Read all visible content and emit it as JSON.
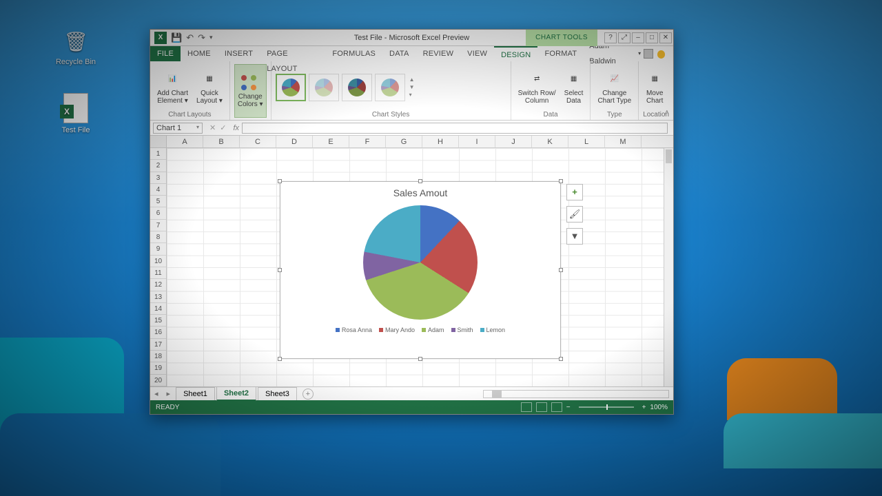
{
  "desktop": {
    "recycle": "Recycle Bin",
    "testfile": "Test File"
  },
  "window": {
    "title": "Test File - Microsoft Excel Preview",
    "contextual_tab": "CHART TOOLS",
    "user": "Adam Baldwin"
  },
  "tabs": {
    "file": "FILE",
    "home": "HOME",
    "insert": "INSERT",
    "pagelayout": "PAGE LAYOUT",
    "formulas": "FORMULAS",
    "data": "DATA",
    "review": "REVIEW",
    "view": "VIEW",
    "design": "DESIGN",
    "format": "FORMAT"
  },
  "ribbon": {
    "g1": {
      "btn1": "Add Chart\nElement ▾",
      "btn2": "Quick\nLayout ▾",
      "label": "Chart Layouts"
    },
    "g2": {
      "btn": "Change\nColors ▾",
      "label": ""
    },
    "g3": {
      "label": "Chart Styles"
    },
    "g4": {
      "btn1": "Switch Row/\nColumn",
      "btn2": "Select\nData",
      "label": "Data"
    },
    "g5": {
      "btn": "Change\nChart Type",
      "label": "Type"
    },
    "g6": {
      "btn": "Move\nChart",
      "label": "Location"
    }
  },
  "fx": {
    "namebox": "Chart 1"
  },
  "cols": [
    "A",
    "B",
    "C",
    "D",
    "E",
    "F",
    "G",
    "H",
    "I",
    "J",
    "K",
    "L",
    "M"
  ],
  "rows": [
    "1",
    "2",
    "3",
    "4",
    "5",
    "6",
    "7",
    "8",
    "9",
    "10",
    "11",
    "12",
    "13",
    "14",
    "15",
    "16",
    "17",
    "18",
    "19",
    "20"
  ],
  "chart_data": {
    "type": "pie",
    "title": "Sales Amout",
    "series": [
      {
        "name": "Rosa Anna",
        "value": 12,
        "color": "#4472c4"
      },
      {
        "name": "Mary Ando",
        "value": 22,
        "color": "#c0504d"
      },
      {
        "name": "Adam",
        "value": 36,
        "color": "#9bbb59"
      },
      {
        "name": "Smith",
        "value": 8,
        "color": "#8064a2"
      },
      {
        "name": "Lemon",
        "value": 22,
        "color": "#4bacc6"
      }
    ]
  },
  "sheets": {
    "s1": "Sheet1",
    "s2": "Sheet2",
    "s3": "Sheet3"
  },
  "status": {
    "ready": "READY",
    "zoom": "100%"
  }
}
